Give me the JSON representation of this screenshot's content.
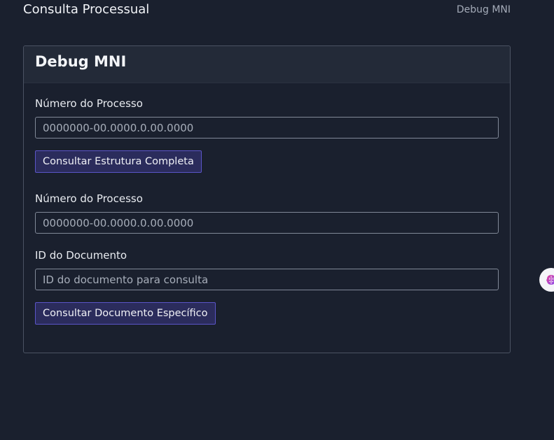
{
  "header": {
    "app_title": "Consulta Processual",
    "nav_link": "Debug MNI"
  },
  "card": {
    "title": "Debug MNI",
    "structure_form": {
      "process_label": "Número do Processo",
      "process_placeholder": "0000000-00.0000.0.00.0000",
      "process_value": "",
      "submit_label": "Consultar Estrutura Completa"
    },
    "document_form": {
      "process_label": "Número do Processo",
      "process_placeholder": "0000000-00.0000.0.00.0000",
      "process_value": "",
      "document_label": "ID do Documento",
      "document_placeholder": "ID do documento para consulta",
      "document_value": "",
      "submit_label": "Consultar Documento Específico"
    }
  },
  "widget": {
    "icon": "assistant-brain-icon",
    "colors": [
      "#e0409a",
      "#8a4cf0"
    ]
  },
  "colors": {
    "background": "#1a202e",
    "card_header": "#232a38",
    "button_bg": "#2b2c5c",
    "button_border": "#5b55c8"
  }
}
